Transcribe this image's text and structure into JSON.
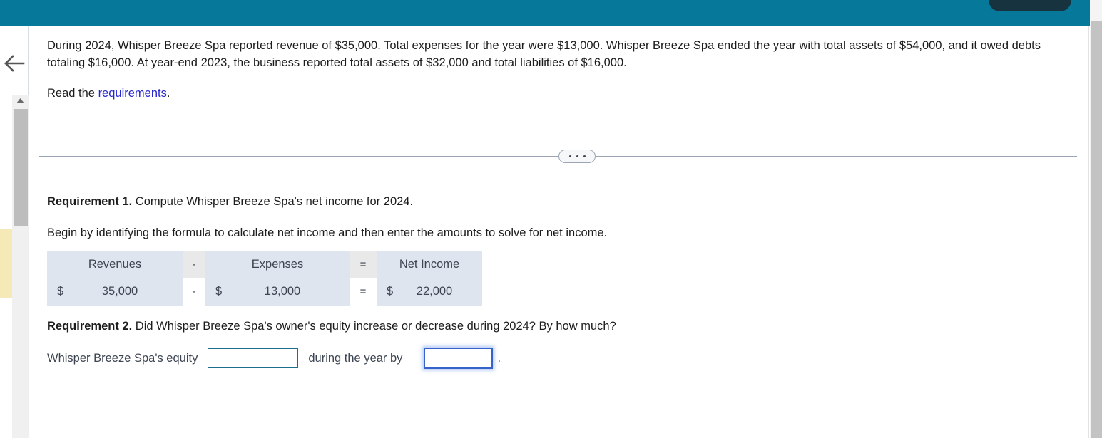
{
  "top_bar": {
    "color": "#06799a",
    "pill_color": "#17333f"
  },
  "gutter": {
    "back_icon": "back-arrow-icon",
    "highlight_color": "#f6e9b8"
  },
  "problem": {
    "text": "During 2024, Whisper Breeze Spa reported revenue of $35,000. Total expenses for the year were $13,000. Whisper Breeze Spa ended the year with total assets of $54,000, and it owed debts totaling $16,000. At year-end 2023, the business reported total assets of $32,000 and total liabilities of $16,000.",
    "read_prefix": "Read the ",
    "read_link": "requirements",
    "read_suffix": "."
  },
  "divider": {
    "ellipsis_label": "more-options"
  },
  "requirement1": {
    "label": "Requirement 1.",
    "prompt": " Compute Whisper Breeze Spa's net income for 2024.",
    "instruction": "Begin by identifying the formula to calculate net income and then enter the amounts to solve for net income."
  },
  "formula": {
    "headers": {
      "revenues": "Revenues",
      "op1": "-",
      "expenses": "Expenses",
      "op2": "=",
      "net_income": "Net Income"
    },
    "values": {
      "revenues_currency": "$",
      "revenues": "35,000",
      "op1": "-",
      "expenses_currency": "$",
      "expenses": "13,000",
      "op2": "=",
      "net_income_currency": "$",
      "net_income": "22,000"
    }
  },
  "requirement2": {
    "label": "Requirement 2.",
    "prompt": " Did Whisper Breeze Spa's owner's equity increase or decrease during 2024? By how much?",
    "answer_prefix": "Whisper Breeze Spa's equity",
    "direction_value": "",
    "direction_placeholder": "",
    "middle_text": "during the year by",
    "amount_value": "",
    "amount_placeholder": "",
    "suffix": "."
  }
}
